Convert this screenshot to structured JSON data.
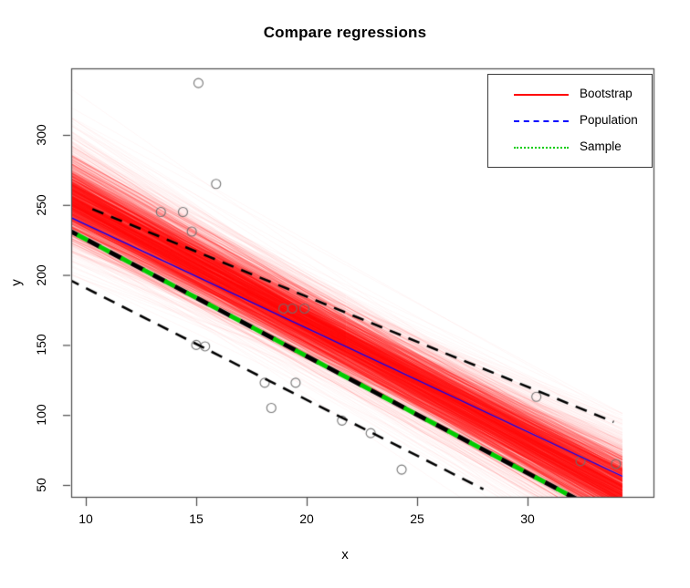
{
  "chart_data": {
    "type": "line",
    "title": "Compare regressions",
    "xlabel": "x",
    "ylabel": "y",
    "xlim": [
      9.1,
      34.3
    ],
    "ylim": [
      42,
      345
    ],
    "xticks": [
      10,
      15,
      20,
      25,
      30
    ],
    "yticks": [
      50,
      100,
      150,
      200,
      250,
      300
    ],
    "grid": false,
    "legend": {
      "position": "top-right",
      "entries": [
        {
          "label": "Bootstrap",
          "color": "#ff0000",
          "style": "solid"
        },
        {
          "label": "Population",
          "color": "#0000ff",
          "style": "dashed"
        },
        {
          "label": "Sample",
          "color": "#00cc00",
          "style": "dotted"
        }
      ]
    },
    "series": [
      {
        "name": "Population",
        "type": "line",
        "color": "#0000ff",
        "style": "solid",
        "intercept": 310.0,
        "slope": -7.4,
        "x": [
          9.1,
          34.3
        ],
        "y": [
          242.7,
          56.2
        ]
      },
      {
        "name": "Sample",
        "type": "line",
        "color": "#00cc00",
        "style": "dash-dot",
        "intercept": 309.0,
        "slope": -8.35,
        "x": [
          9.1,
          32.6
        ],
        "y": [
          233.0,
          36.8
        ]
      },
      {
        "name": "Confidence band upper",
        "type": "line",
        "color": "#000000",
        "style": "dashed",
        "x": [
          10.3,
          33.9
        ],
        "y": [
          247.0,
          95.0
        ]
      },
      {
        "name": "Confidence band lower",
        "type": "line",
        "color": "#000000",
        "style": "dashed",
        "x": [
          9.2,
          28.0
        ],
        "y": [
          197.0,
          47.0
        ]
      }
    ],
    "bootstrap": {
      "name": "Bootstrap",
      "color": "#ff0000",
      "n_lines": 1000,
      "description": "Overplotted semi-transparent red regression lines fanning about the sample fit",
      "pivot_x": 21.0,
      "pivot_y": 158.0,
      "intercept_mean": 309.0,
      "slope_mean": -8.35,
      "slope_sd": 1.05,
      "intercept_sd": 22.0
    },
    "scatter": {
      "name": "Sample observations",
      "marker": "open-circle",
      "color": "#808080",
      "points": [
        {
          "x": 15.1,
          "y": 337
        },
        {
          "x": 15.9,
          "y": 265
        },
        {
          "x": 13.4,
          "y": 245
        },
        {
          "x": 14.4,
          "y": 245
        },
        {
          "x": 14.8,
          "y": 231
        },
        {
          "x": 15.0,
          "y": 150
        },
        {
          "x": 15.4,
          "y": 149
        },
        {
          "x": 18.95,
          "y": 176
        },
        {
          "x": 19.35,
          "y": 176
        },
        {
          "x": 19.9,
          "y": 176
        },
        {
          "x": 18.1,
          "y": 123
        },
        {
          "x": 19.5,
          "y": 123
        },
        {
          "x": 18.4,
          "y": 105
        },
        {
          "x": 21.6,
          "y": 96
        },
        {
          "x": 22.9,
          "y": 87
        },
        {
          "x": 24.3,
          "y": 61
        },
        {
          "x": 30.4,
          "y": 113
        },
        {
          "x": 32.4,
          "y": 67
        },
        {
          "x": 34.0,
          "y": 65
        }
      ]
    }
  }
}
